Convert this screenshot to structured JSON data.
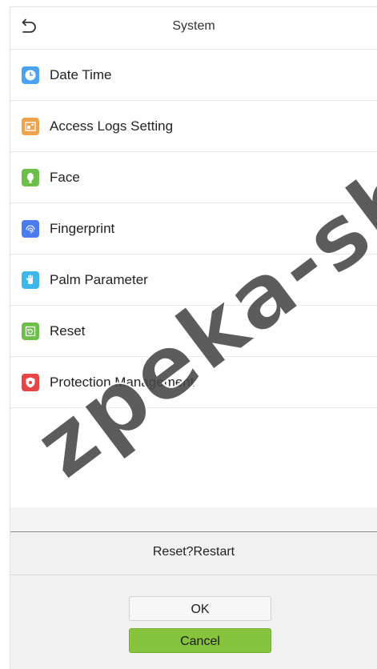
{
  "header": {
    "title": "System",
    "back_icon": "back-arrow-icon"
  },
  "menu": {
    "items": [
      {
        "label": "Date Time",
        "icon": "clock-icon",
        "color": "#4aa3f0"
      },
      {
        "label": "Access Logs Setting",
        "icon": "logs-icon",
        "color": "#f0a24a"
      },
      {
        "label": "Face",
        "icon": "face-icon",
        "color": "#6cc04a"
      },
      {
        "label": "Fingerprint",
        "icon": "fingerprint-icon",
        "color": "#4a7cf0"
      },
      {
        "label": "Palm Parameter",
        "icon": "palm-icon",
        "color": "#3fb7e8"
      },
      {
        "label": "Reset",
        "icon": "reset-icon",
        "color": "#6cc04a"
      },
      {
        "label": "Protection Management",
        "icon": "shield-icon",
        "color": "#e84545"
      }
    ]
  },
  "dialog": {
    "message": "Reset?Restart",
    "ok_label": "OK",
    "cancel_label": "Cancel",
    "cancel_color": "#86c43e"
  },
  "watermark": {
    "text": "zpeka-sh"
  }
}
